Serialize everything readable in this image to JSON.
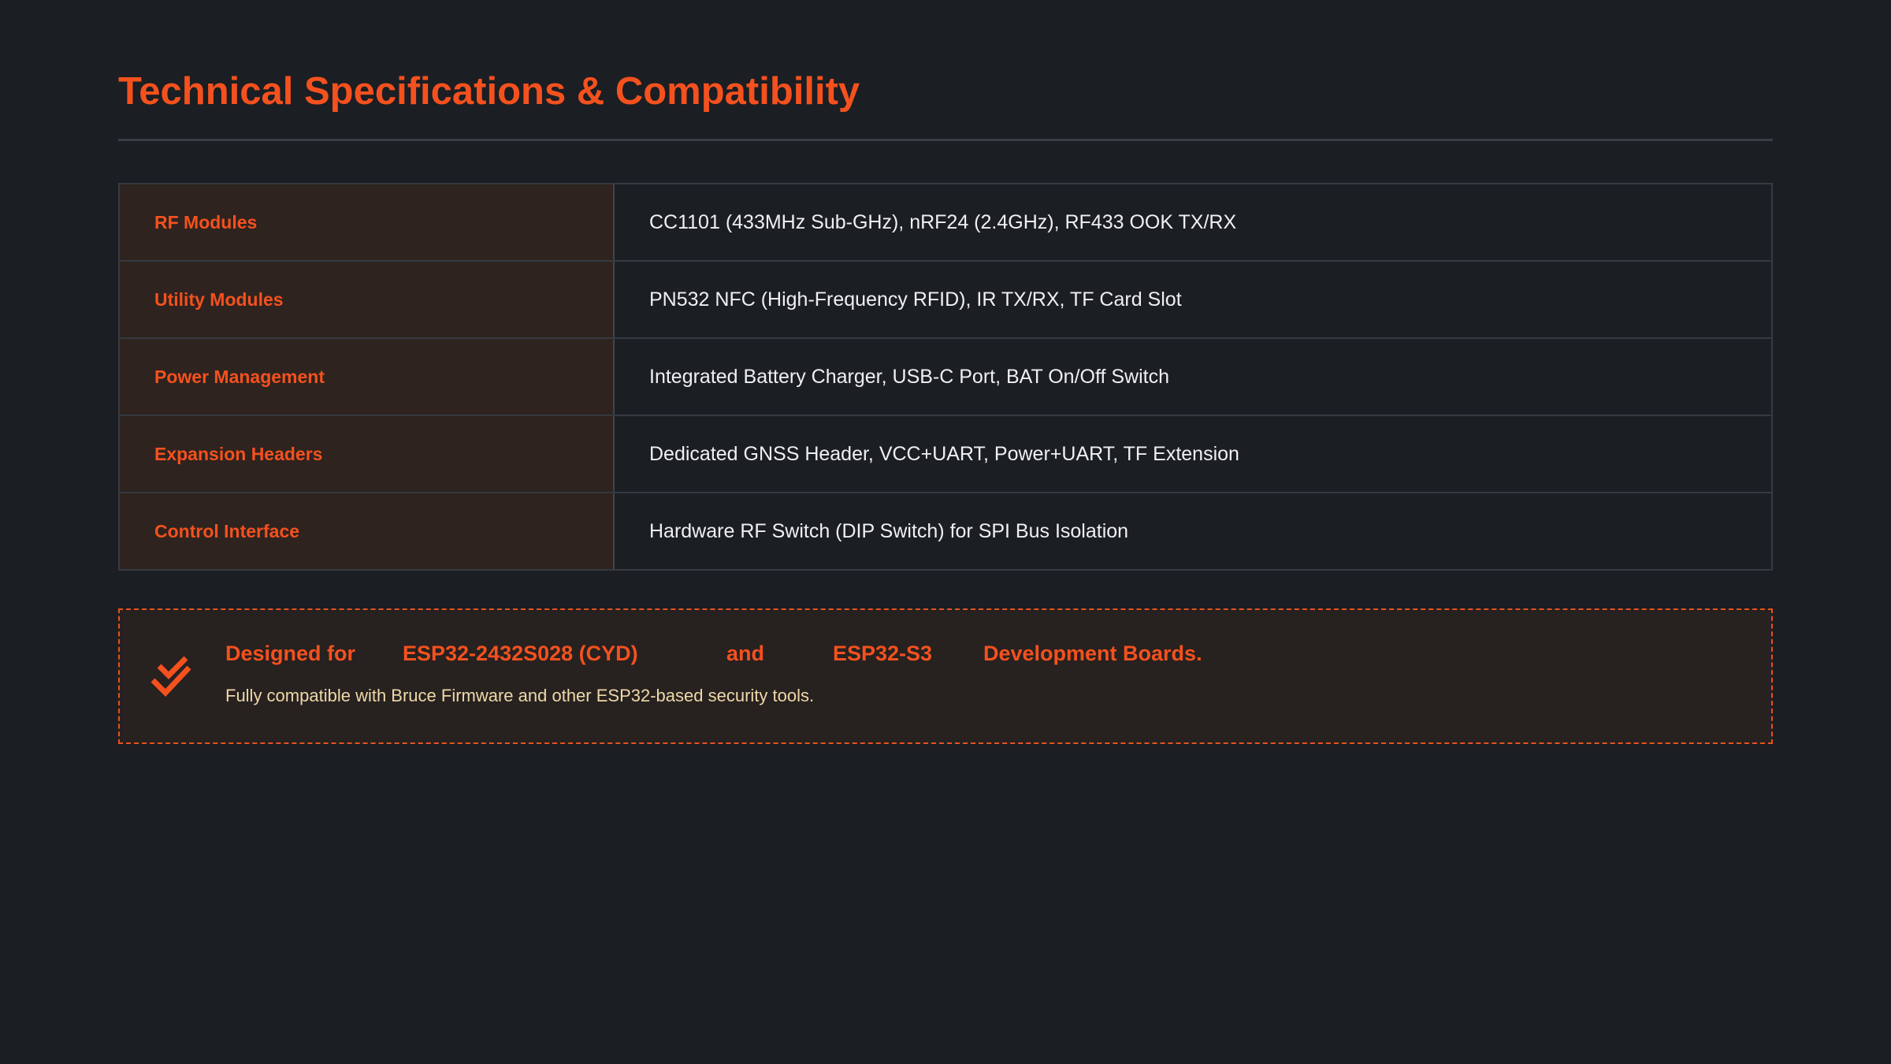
{
  "title": "Technical Specifications & Compatibility",
  "specs": [
    {
      "label": "RF Modules",
      "value": "CC1101 (433MHz Sub-GHz), nRF24 (2.4GHz), RF433 OOK TX/RX"
    },
    {
      "label": "Utility Modules",
      "value": "PN532 NFC (High-Frequency RFID), IR TX/RX, TF Card Slot"
    },
    {
      "label": "Power Management",
      "value": "Integrated Battery Charger, USB-C Port, BAT On/Off Switch"
    },
    {
      "label": "Expansion Headers",
      "value": "Dedicated GNSS Header, VCC+UART, Power+UART, TF Extension"
    },
    {
      "label": "Control Interface",
      "value": "Hardware RF Switch (DIP Switch) for SPI Bus Isolation"
    }
  ],
  "compat": {
    "icon": "double-check-icon",
    "headline_prefix": "Designed for",
    "board_1": "ESP32-2432S028 (CYD)",
    "conjunction": "and",
    "board_2": "ESP32-S3",
    "headline_suffix": "Development Boards.",
    "subtext": "Fully compatible with Bruce Firmware and other ESP32-based security tools."
  },
  "colors": {
    "background": "#1b1e23",
    "accent": "#f4511e",
    "label_cell": "#2e231f",
    "subtext": "#efd9a8"
  }
}
